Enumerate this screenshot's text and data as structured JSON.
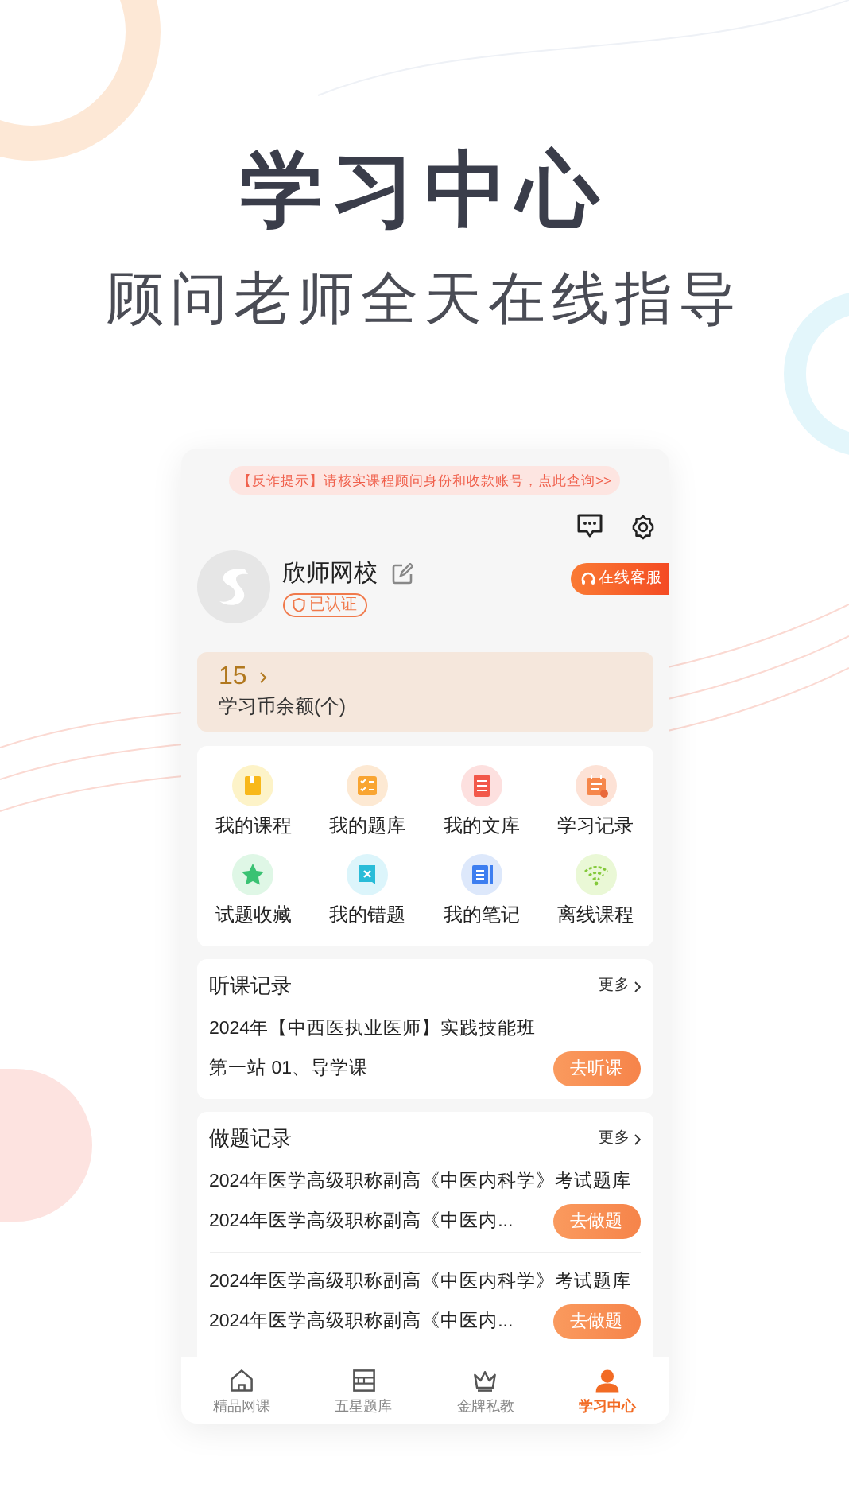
{
  "headline": "学习中心",
  "subheadline": "顾问老师全天在线指导",
  "app": {
    "notice": "【反诈提示】请核实课程顾问身份和收款账号，点此查询>>",
    "profile": {
      "name": "欣师网校",
      "badge": "已认证"
    },
    "support_button": "在线客服",
    "coins": {
      "value": "15",
      "label": "学习币余额(个)"
    },
    "shortcuts": [
      {
        "label": "我的课程",
        "kind": "book"
      },
      {
        "label": "我的题库",
        "kind": "checklist"
      },
      {
        "label": "我的文库",
        "kind": "document"
      },
      {
        "label": "学习记录",
        "kind": "calendar"
      },
      {
        "label": "试题收藏",
        "kind": "star"
      },
      {
        "label": "我的错题",
        "kind": "mistake"
      },
      {
        "label": "我的笔记",
        "kind": "notebook"
      },
      {
        "label": "离线课程",
        "kind": "wifi"
      }
    ],
    "listen_history": {
      "title": "听课记录",
      "more": "更多",
      "items": [
        {
          "lines": [
            "2024年【中西医执业医师】实践技能班",
            "第一站 01、导学课"
          ],
          "button": "去听课"
        }
      ]
    },
    "practice_history": {
      "title": "做题记录",
      "more": "更多",
      "items": [
        {
          "lines": [
            "2024年医学高级职称副高《中医内科学》考试题库",
            "2024年医学高级职称副高《中医内..."
          ],
          "button": "去做题"
        },
        {
          "lines": [
            "2024年医学高级职称副高《中医内科学》考试题库",
            "2024年医学高级职称副高《中医内..."
          ],
          "button": "去做题"
        }
      ]
    },
    "tab_bar": [
      {
        "label": "精品网课",
        "kind": "home",
        "selected": false
      },
      {
        "label": "五星题库",
        "kind": "bank",
        "selected": false
      },
      {
        "label": "金牌私教",
        "kind": "crown",
        "selected": false
      },
      {
        "label": "学习中心",
        "kind": "person",
        "selected": true
      }
    ]
  }
}
